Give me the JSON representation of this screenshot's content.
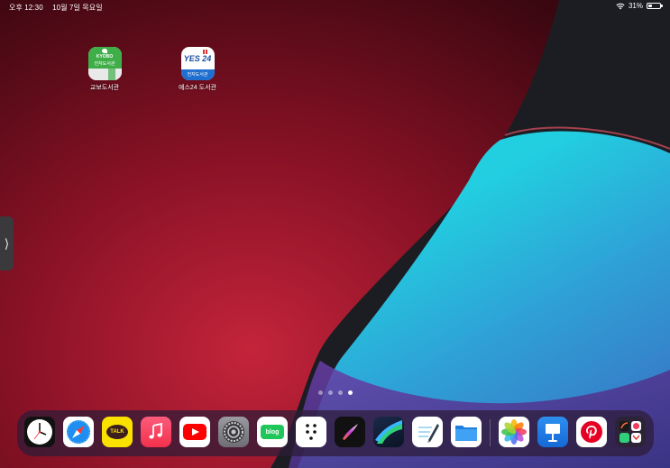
{
  "status_bar": {
    "time": "오후 12:30",
    "date": "10월 7일 목요일",
    "battery_percent": "31%",
    "battery_level": 0.31
  },
  "home_apps": [
    {
      "name": "교보도서관",
      "icon": "kyobo-library-icon",
      "icon_text_top": "KYOBO",
      "icon_text_bottom": "전자도서관"
    },
    {
      "name": "예스24 도서관",
      "icon": "yes24-library-icon",
      "icon_text_top": "YES 24",
      "icon_text_bottom": "전자도서관"
    }
  ],
  "page_indicator": {
    "count": 4,
    "active": 4
  },
  "dock": {
    "apps": [
      {
        "icon": "clock-icon"
      },
      {
        "icon": "safari-icon"
      },
      {
        "icon": "kakaotalk-icon",
        "text": "TALK"
      },
      {
        "icon": "music-icon"
      },
      {
        "icon": "youtube-icon"
      },
      {
        "icon": "settings-icon"
      },
      {
        "icon": "naver-blog-icon",
        "text": "blog"
      },
      {
        "icon": "dots-app-icon"
      },
      {
        "icon": "procreate-icon"
      },
      {
        "icon": "lumafusion-icon"
      },
      {
        "icon": "notes-pen-icon"
      },
      {
        "icon": "files-icon"
      },
      {
        "icon": "photos-icon"
      },
      {
        "icon": "keynote-icon"
      },
      {
        "icon": "pinterest-icon"
      },
      {
        "icon": "app-library-icon"
      }
    ]
  },
  "colors": {
    "wallpaper_red": "#6b0d1c",
    "wallpaper_cyan": "#1cc7d8",
    "wallpaper_dark": "#1b1d22"
  }
}
